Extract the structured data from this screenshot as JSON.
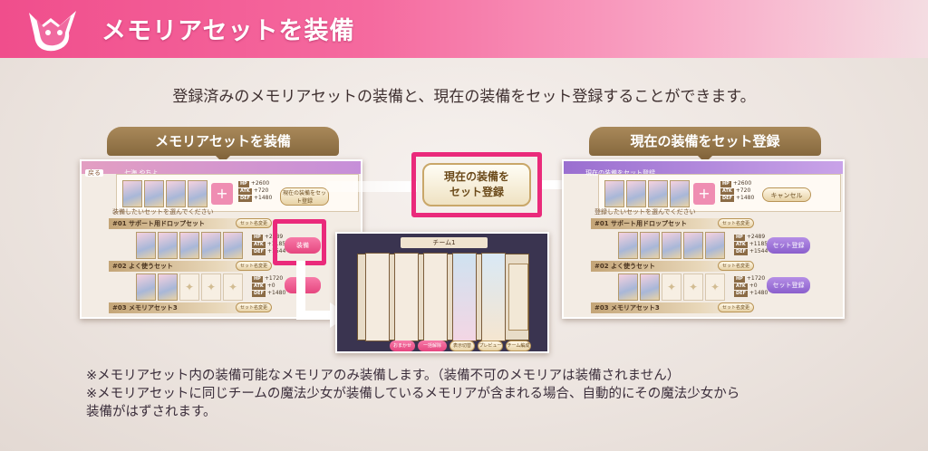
{
  "header": {
    "title": "メモリアセットを装備",
    "logo_icon": "pink-cat-mascot-icon"
  },
  "intro": "登録済みのメモリアセットの装備と、現在の装備をセット登録することができます。",
  "left_panel": {
    "label": "メモリアセットを装備",
    "back_button": "戻る",
    "character_name": "七海 やちよ",
    "stats": {
      "hp": "+2600",
      "atk": "+720",
      "def": "+1480"
    },
    "register_button": "現在の装備をセット登録",
    "select_prompt": "装備したいセットを選んでください",
    "sets": [
      {
        "num": "#01",
        "title": "サポート用ドロップセット",
        "stats": {
          "hp": "+2489",
          "atk": "+1185",
          "def": "+1544"
        },
        "set_change": "セット名変更",
        "button": "装備"
      },
      {
        "num": "#02",
        "title": "よく使うセット",
        "stats": {
          "hp": "+1720",
          "atk": "+0",
          "def": "+1480"
        },
        "set_change": "セット名変更"
      },
      {
        "num": "#03",
        "title": "メモリアセット3",
        "set_change": "セット名変更"
      }
    ]
  },
  "center_button": {
    "line1": "現在の装備を",
    "line2": "セット登録"
  },
  "right_panel": {
    "label": "現在の装備をセット登録",
    "topbar_title": "現在の装備をセット登録",
    "stats": {
      "hp": "+2600",
      "atk": "+720",
      "def": "+1480"
    },
    "cancel_button": "キャンセル",
    "select_prompt": "登録したいセットを選んでください",
    "sets": [
      {
        "num": "#01",
        "title": "サポート用ドロップセット",
        "stats": {
          "hp": "+2489",
          "atk": "+1185",
          "def": "+1544"
        },
        "button": "セット登録",
        "set_change": "セット名変更"
      },
      {
        "num": "#02",
        "title": "よく使うセット",
        "stats": {
          "hp": "+1720",
          "atk": "+0",
          "def": "+1480"
        },
        "button": "セット登録",
        "set_change": "セット名変更"
      },
      {
        "num": "#03",
        "title": "メモリアセット3",
        "set_change": "セット名変更"
      }
    ]
  },
  "team_screen": {
    "title": "チーム1",
    "buttons": [
      "おまかせ",
      "一括解除",
      "表示切替",
      "プレビュー",
      "チーム編成"
    ]
  },
  "notes": [
    "※メモリアセット内の装備可能なメモリアのみ装備します。（装備不可のメモリアは装備されません）",
    "※メモリアセットに同じチームの魔法少女が装備しているメモリアが含まれる場合、自動的にその魔法少女から",
    "装備がはずされます。"
  ],
  "colors": {
    "accent_pink": "#ea2a7b",
    "header_pink": "#f04e8c",
    "label_gold": "#86683e",
    "register_purple": "#8a5fcc"
  }
}
